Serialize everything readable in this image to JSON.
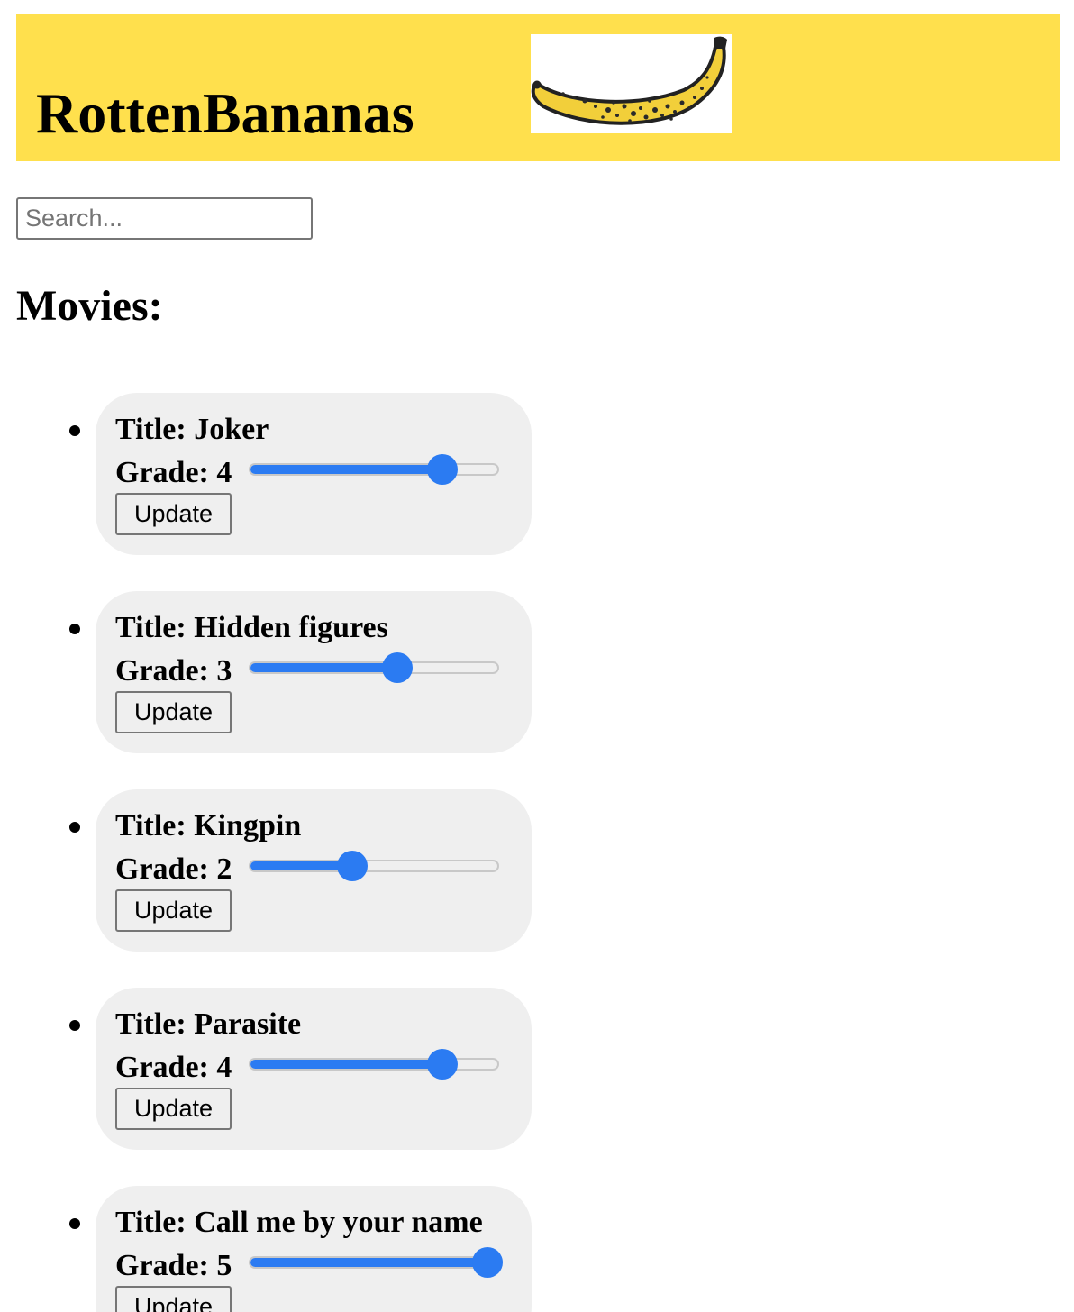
{
  "header": {
    "title": "RottenBananas",
    "logo_icon": "banana-icon",
    "background_color": "#ffe04d"
  },
  "search": {
    "placeholder": "Search...",
    "value": ""
  },
  "main": {
    "section_title": "Movies:",
    "update_label": "Update",
    "grade_min": 0,
    "grade_max": 5,
    "accent_color": "#2b7bf2",
    "movies": [
      {
        "title_text": "Title: Joker",
        "grade_text": "Grade: 4",
        "grade": 4
      },
      {
        "title_text": "Title: Hidden figures",
        "grade_text": "Grade: 3",
        "grade": 3
      },
      {
        "title_text": "Title: Kingpin",
        "grade_text": "Grade: 2",
        "grade": 2
      },
      {
        "title_text": "Title: Parasite",
        "grade_text": "Grade: 4",
        "grade": 4
      },
      {
        "title_text": "Title: Call me by your name",
        "grade_text": "Grade: 5",
        "grade": 5
      }
    ]
  }
}
